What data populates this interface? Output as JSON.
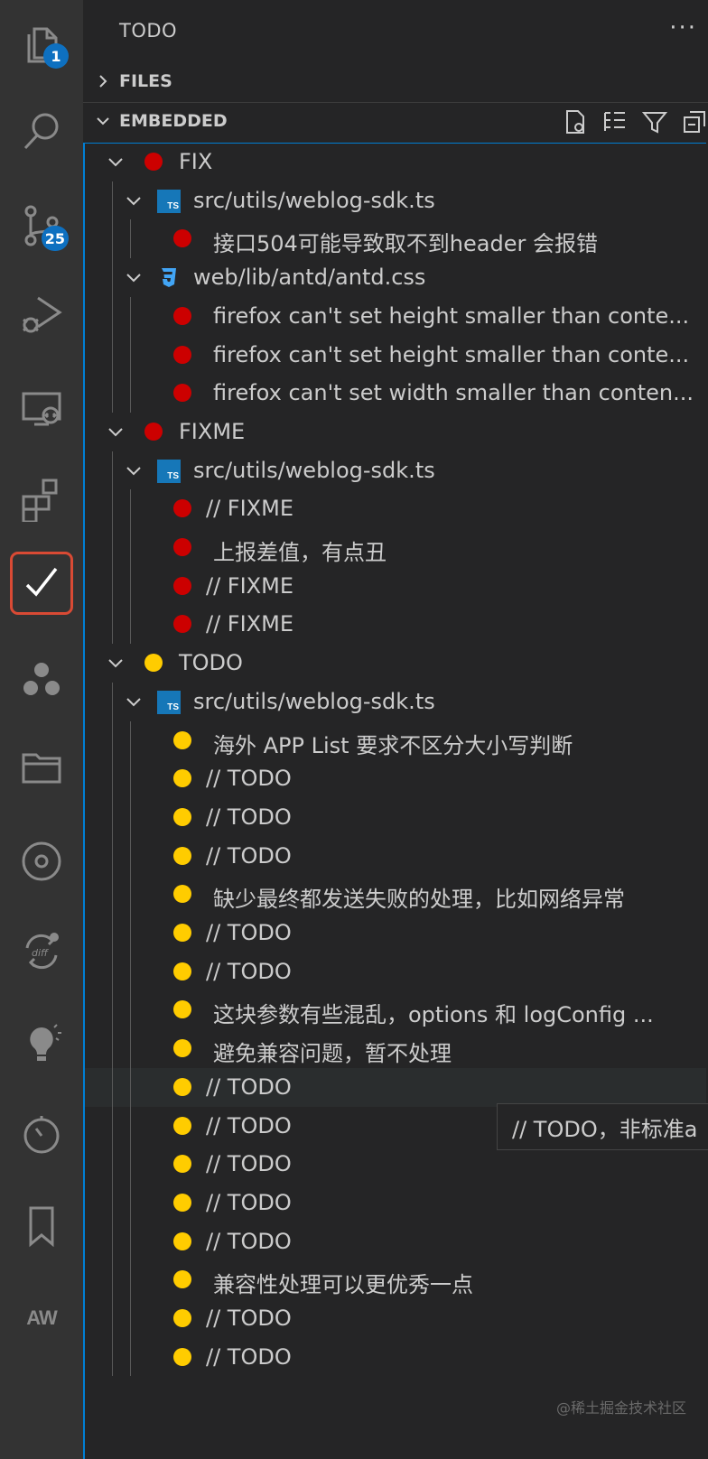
{
  "activity_bar": {
    "explorer_badge": "1",
    "scm_badge": "25",
    "bottom_label": "AW"
  },
  "sidebar": {
    "title": "TODO",
    "more": "···",
    "files_section": "FILES",
    "embedded_section": "EMBEDDED"
  },
  "tooltip": "// TODO，非标准a",
  "watermark": "@稀土掘金技术社区",
  "colors": {
    "fix": "#cc0000",
    "todo": "#ffcc00",
    "accent": "#007fd4"
  },
  "tree": {
    "fix_group": "FIX",
    "fix_file1": "src/utils/weblog-sdk.ts",
    "fix_item1": "接口504可能导致取不到header 会报错",
    "fix_file2": "web/lib/antd/antd.css",
    "fix_item2": "firefox can't set height smaller than conte...",
    "fix_item3": "firefox can't set height smaller than conte...",
    "fix_item4": "firefox can't set width smaller than conten...",
    "fixme_group": "FIXME",
    "fixme_file1": "src/utils/weblog-sdk.ts",
    "fixme_item1": "// FIXME",
    "fixme_item2": "上报差值，有点丑",
    "fixme_item3": "// FIXME",
    "fixme_item4": "// FIXME",
    "todo_group": "TODO",
    "todo_file1": "src/utils/weblog-sdk.ts",
    "todo_items": [
      "海外 APP List 要求不区分大小写判断",
      "// TODO",
      "// TODO",
      "// TODO",
      "缺少最终都发送失败的处理，比如网络异常",
      "// TODO",
      "// TODO",
      "这块参数有些混乱，options 和 logConfig ...",
      "避免兼容问题，暂不处理",
      "// TODO",
      "// TODO",
      "// TODO",
      "// TODO",
      "// TODO",
      "兼容性处理可以更优秀一点",
      "// TODO",
      "// TODO"
    ]
  }
}
